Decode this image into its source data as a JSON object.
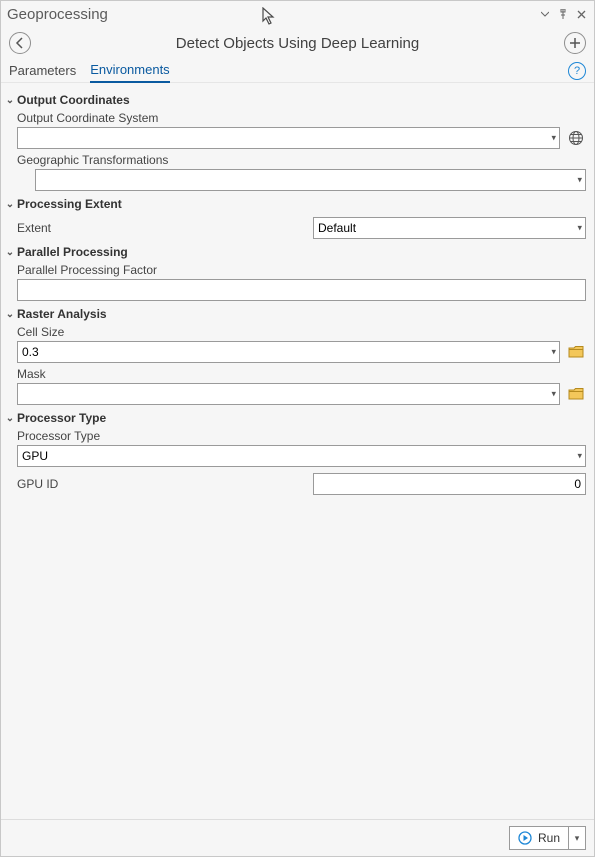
{
  "window": {
    "title": "Geoprocessing"
  },
  "header": {
    "tool_title": "Detect Objects Using Deep Learning"
  },
  "tabs": {
    "parameters": "Parameters",
    "environments": "Environments",
    "active": "environments"
  },
  "sections": {
    "output_coordinates": {
      "title": "Output Coordinates",
      "output_coord_system": {
        "label": "Output Coordinate System",
        "value": ""
      },
      "geo_transformations": {
        "label": "Geographic Transformations",
        "value": ""
      }
    },
    "processing_extent": {
      "title": "Processing Extent",
      "extent": {
        "label": "Extent",
        "value": "Default"
      }
    },
    "parallel_processing": {
      "title": "Parallel Processing",
      "factor": {
        "label": "Parallel Processing Factor",
        "value": ""
      }
    },
    "raster_analysis": {
      "title": "Raster Analysis",
      "cell_size": {
        "label": "Cell Size",
        "value": "0.3"
      },
      "mask": {
        "label": "Mask",
        "value": ""
      }
    },
    "processor_type": {
      "title": "Processor Type",
      "type": {
        "label": "Processor Type",
        "value": "GPU"
      },
      "gpu_id": {
        "label": "GPU ID",
        "value": "0"
      }
    }
  },
  "footer": {
    "run_label": "Run"
  },
  "icons": {
    "back": "back-arrow-icon",
    "add": "plus-icon",
    "help": "help-icon",
    "globe": "globe-icon",
    "folder": "folder-icon",
    "play": "play-icon",
    "menu": "menu-dropdown-icon",
    "pin": "pin-icon",
    "close": "close-icon"
  }
}
